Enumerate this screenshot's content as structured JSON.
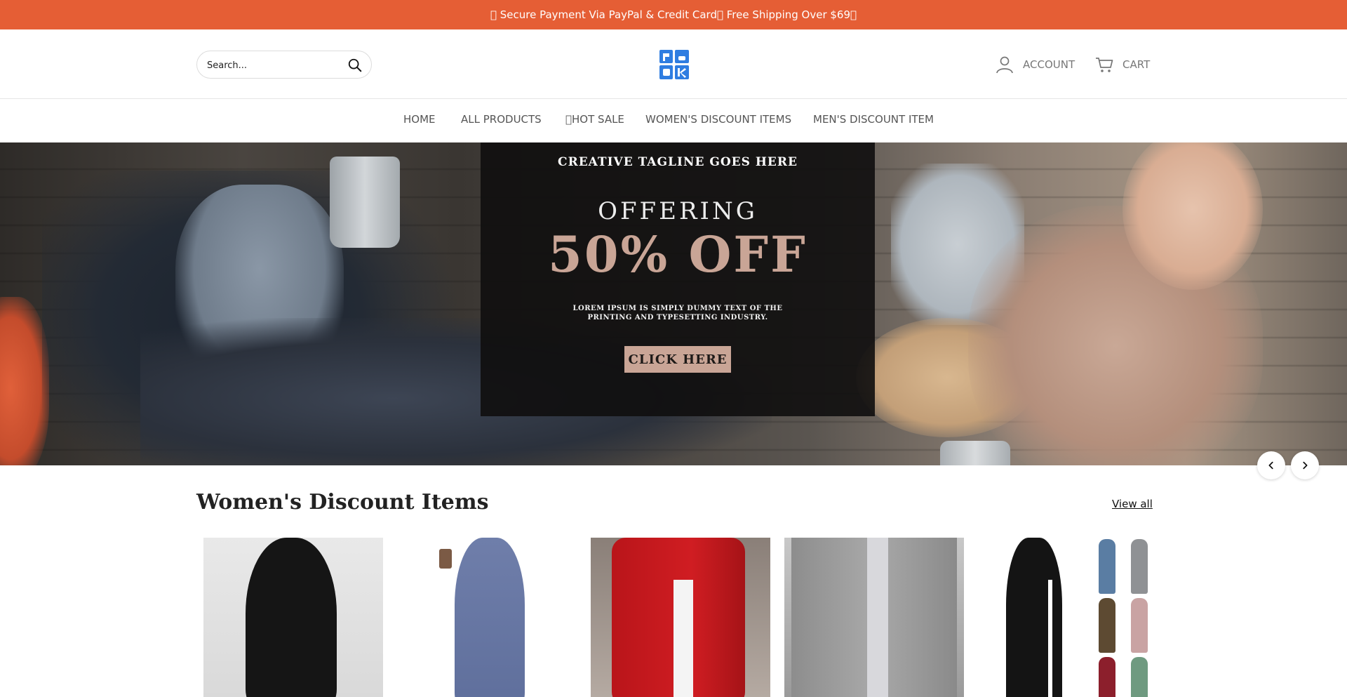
{
  "announcement": "\u0000 Secure Payment Via PayPal & Credit Card\u0000 Free Shipping Over $69\u0000",
  "search": {
    "placeholder": "Search..."
  },
  "logo": {
    "alt": "RACK"
  },
  "header": {
    "account_label": "ACCOUNT",
    "cart_label": "CART"
  },
  "nav": {
    "items": [
      {
        "label": "HOME"
      },
      {
        "label": "ALL PRODUCTS"
      },
      {
        "label": "\u0000HOT SALE"
      },
      {
        "label": "WOMEN'S DISCOUNT ITEMS"
      },
      {
        "label": "MEN'S DISCOUNT ITEM"
      }
    ]
  },
  "hero": {
    "tagline": "CREATIVE TAGLINE GOES HERE",
    "offering": "OFFERING",
    "discount": "50% OFF",
    "body": "LOREM IPSUM IS SIMPLY DUMMY TEXT OF THE PRINTING AND TYPESETTING INDUSTRY.",
    "cta": "CLICK HERE"
  },
  "section": {
    "title": "Women's Discount Items",
    "view_all": "View all"
  },
  "colors": {
    "announcement_bg": "#e55e35",
    "accent": "#c9a596",
    "logo_blue": "#2f7de1"
  },
  "icons": {
    "search": "search-icon",
    "account": "user-icon",
    "cart": "cart-icon",
    "prev": "chevron-left-icon",
    "next": "chevron-right-icon"
  }
}
